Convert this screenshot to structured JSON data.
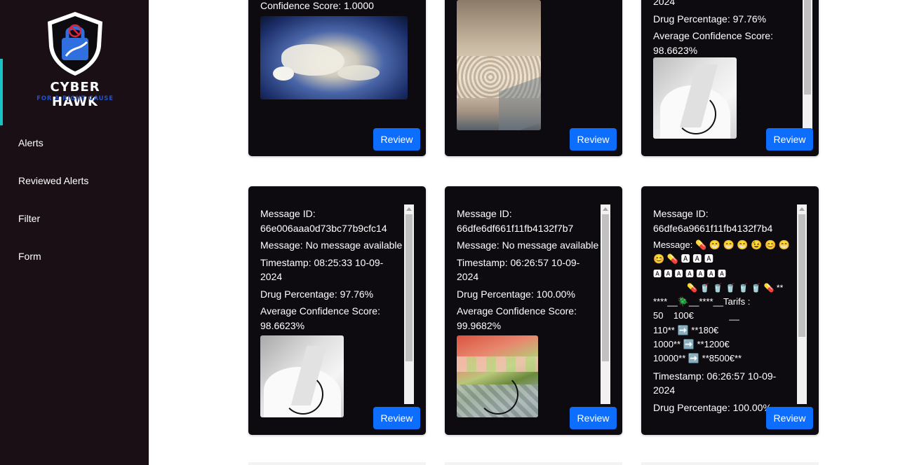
{
  "brand": {
    "name": "CYBER HAWK",
    "tagline": "FOR A RIGHT CAUSE",
    "accent_color": "#19c3c3"
  },
  "nav": {
    "items": [
      {
        "label": "Alerts"
      },
      {
        "label": "Reviewed Alerts"
      },
      {
        "label": "Filter"
      },
      {
        "label": "Form"
      }
    ]
  },
  "button_color": "#0d6efd",
  "cards_top": [
    {
      "lines": [
        "Confidence Score: 1.0000"
      ],
      "review_label": "Review"
    },
    {
      "lines": [],
      "review_label": "Review"
    },
    {
      "lines": [
        "2024",
        "Drug Percentage: 97.76%",
        "Average Confidence Score: 98.6623%"
      ],
      "review_label": "Review"
    }
  ],
  "cards_bottom": [
    {
      "message_id_label": "Message ID:",
      "message_id": "66e006aaa0d73bc77b9cfc14",
      "message": "Message: No message available",
      "timestamp": "Timestamp: 08:25:33 10-09-2024",
      "drug_percentage": "Drug Percentage: 97.76%",
      "confidence": "Average Confidence Score: 98.6623%",
      "review_label": "Review"
    },
    {
      "message_id_label": "Message ID:",
      "message_id": "66dfe6df661f11fb4132f7b7",
      "message": "Message: No message available",
      "timestamp": "Timestamp: 06:26:57 10-09-2024",
      "drug_percentage": "Drug Percentage: 100.00%",
      "confidence": "Average Confidence Score: 99.9682%",
      "review_label": "Review"
    },
    {
      "message_id_label": "Message ID:",
      "message_id": "66dfe6a9661f11fb4132f7b4",
      "message_line1": "Message: 💊 😁 😁 😁 😉 😊 😁",
      "message_line2": "😊 💊 🅰 🅰 🅰",
      "message_line3": "🅰 🅰 🅰 🅰 🅰 🅰 🅰",
      "message_line4": "💊 🥤 🥤 🥤 🥤 🥤 💊 **",
      "message_line5": "****__🪲__****__Tarifs :",
      "message_line6": "50    100€              __",
      "message_line7": "110** ➡️ **180€",
      "message_line8": "1000** ➡️ **1200€",
      "message_line9": "10000** ➡️ **8500€**",
      "timestamp": "Timestamp: 06:26:57 10-09-2024",
      "drug_percentage": "Drug Percentage: 100.00%",
      "review_label": "Review"
    }
  ]
}
